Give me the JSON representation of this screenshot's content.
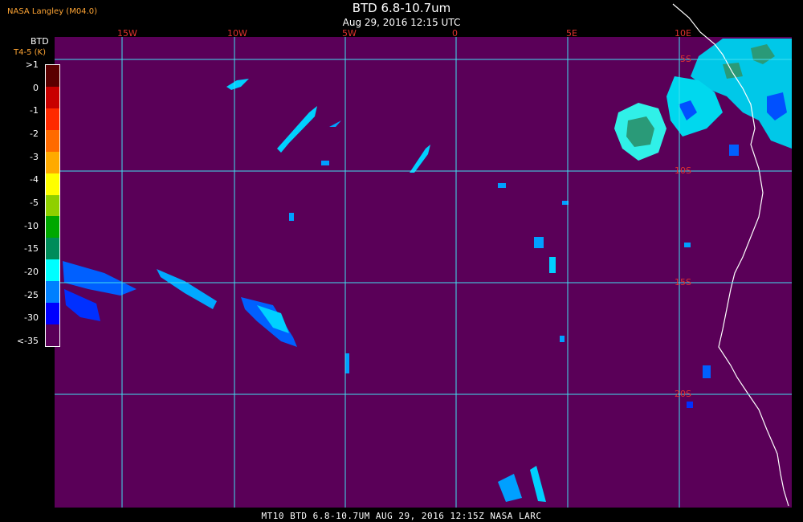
{
  "header": {
    "credit": "NASA Langley (M04.0)",
    "title": "BTD 6.8-10.7um",
    "subtitle": "Aug 29, 2016 12:15 UTC"
  },
  "legend": {
    "title": "BTD",
    "units": "T4-5 (K)",
    "labels": [
      ">1",
      "0",
      "-1",
      "-2",
      "-3",
      "-4",
      "-5",
      "-10",
      "-15",
      "-20",
      "-25",
      "-30",
      "<-35"
    ],
    "colors": [
      "#5a0000",
      "#c80000",
      "#ff2a00",
      "#ff6a00",
      "#ffaa00",
      "#ffff00",
      "#8fd000",
      "#00a800",
      "#008c5a",
      "#00ffff",
      "#0080ff",
      "#0000ff",
      "#5a0058"
    ]
  },
  "map": {
    "background_color": "#5a0058",
    "grid_color": "#40e0f0",
    "coast_color": "#ffffff",
    "lon_labels": [
      "15W",
      "10W",
      "5W",
      "0",
      "5E",
      "10E"
    ],
    "lat_labels": [
      "5S",
      "10S",
      "15S",
      "20S"
    ]
  },
  "footer": {
    "text": "MT10  BTD 6.8-10.7UM  AUG 29, 2016 12:15Z  NASA LARC"
  }
}
